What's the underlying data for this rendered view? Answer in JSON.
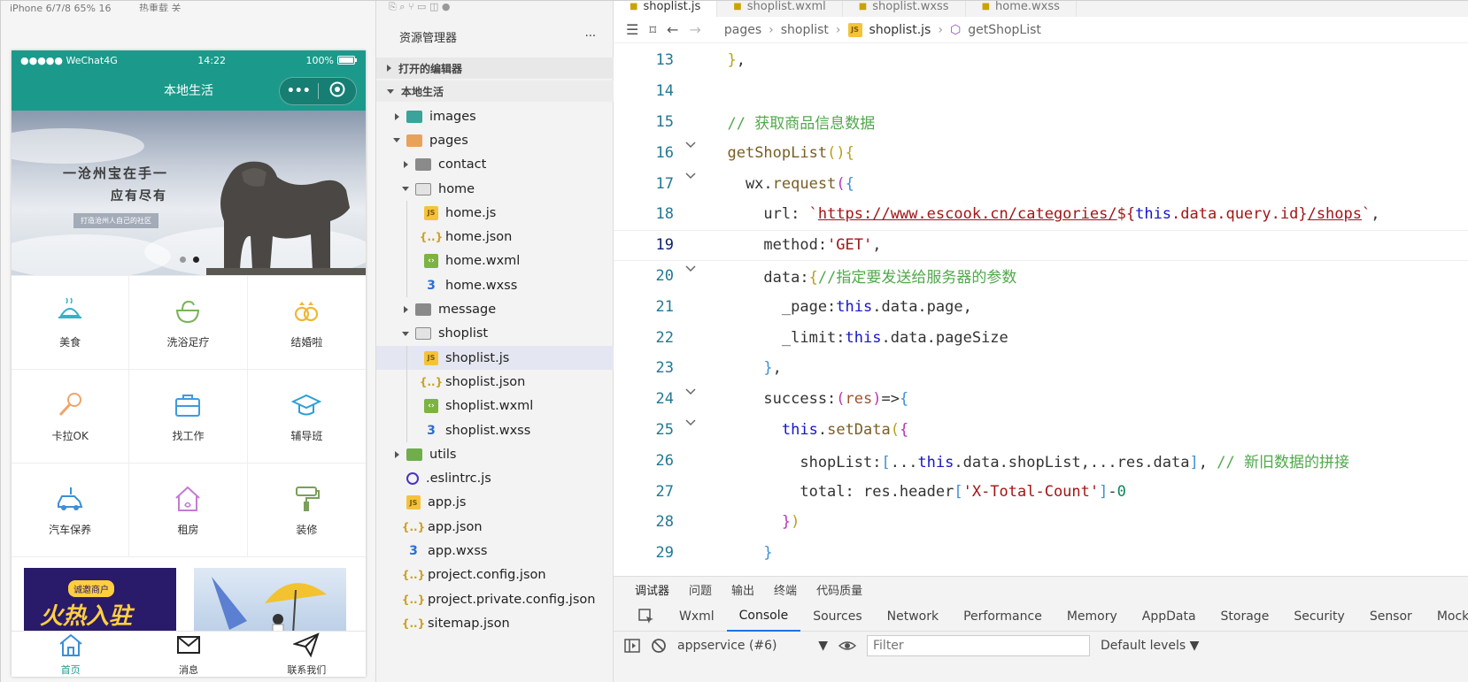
{
  "simulator": {
    "top_device": "iPhone 6/7/8 65% 16",
    "top_hot": "热重载 关",
    "status": {
      "carrier": "●●●●● WeChat4G",
      "time": "14:22",
      "battery": "100%"
    },
    "nav_title": "本地生活",
    "capsule_more": "•••",
    "banner": {
      "line1": "一沧州宝在手一",
      "line2": "应有尽有",
      "line3": "打造沧州人自己的社区"
    },
    "grid": [
      {
        "label": "美食",
        "icon": "food-icon"
      },
      {
        "label": "洗浴足疗",
        "icon": "bath-icon"
      },
      {
        "label": "结婚啦",
        "icon": "rings-icon"
      },
      {
        "label": "卡拉OK",
        "icon": "microphone-icon"
      },
      {
        "label": "找工作",
        "icon": "briefcase-icon"
      },
      {
        "label": "辅导班",
        "icon": "graduation-cap-icon"
      },
      {
        "label": "汽车保养",
        "icon": "car-icon"
      },
      {
        "label": "租房",
        "icon": "house-icon"
      },
      {
        "label": "装修",
        "icon": "paint-roller-icon"
      }
    ],
    "promo1": {
      "badge": "诚邀商户",
      "text": "火热入驻"
    },
    "tabbar": [
      {
        "label": "首页",
        "icon": "home-icon",
        "active": true
      },
      {
        "label": "消息",
        "icon": "envelope-icon",
        "active": false
      },
      {
        "label": "联系我们",
        "icon": "paper-plane-icon",
        "active": false
      }
    ]
  },
  "explorer": {
    "title": "资源管理器",
    "more": "···",
    "section_open": "打开的编辑器",
    "section_project": "本地生活",
    "tree": [
      {
        "label": "images",
        "depth": 0,
        "arrow": "right",
        "icon": "images-folder-icon"
      },
      {
        "label": "pages",
        "depth": 0,
        "arrow": "down",
        "icon": "pages-folder-icon"
      },
      {
        "label": "contact",
        "depth": 1,
        "arrow": "right",
        "icon": "folder-icon"
      },
      {
        "label": "home",
        "depth": 1,
        "arrow": "down",
        "icon": "folder-open-icon"
      },
      {
        "label": "home.js",
        "depth": 2,
        "arrow": "",
        "icon": "js-file-icon"
      },
      {
        "label": "home.json",
        "depth": 2,
        "arrow": "",
        "icon": "json-file-icon"
      },
      {
        "label": "home.wxml",
        "depth": 2,
        "arrow": "",
        "icon": "wxml-file-icon"
      },
      {
        "label": "home.wxss",
        "depth": 2,
        "arrow": "",
        "icon": "wxss-file-icon"
      },
      {
        "label": "message",
        "depth": 1,
        "arrow": "right",
        "icon": "folder-icon"
      },
      {
        "label": "shoplist",
        "depth": 1,
        "arrow": "down",
        "icon": "folder-open-icon"
      },
      {
        "label": "shoplist.js",
        "depth": 2,
        "arrow": "",
        "icon": "js-file-icon",
        "selected": true
      },
      {
        "label": "shoplist.json",
        "depth": 2,
        "arrow": "",
        "icon": "json-file-icon"
      },
      {
        "label": "shoplist.wxml",
        "depth": 2,
        "arrow": "",
        "icon": "wxml-file-icon"
      },
      {
        "label": "shoplist.wxss",
        "depth": 2,
        "arrow": "",
        "icon": "wxss-file-icon"
      },
      {
        "label": "utils",
        "depth": 0,
        "arrow": "right",
        "icon": "utils-folder-icon"
      },
      {
        "label": ".eslintrc.js",
        "depth": 0,
        "arrow": "",
        "icon": "eslint-file-icon"
      },
      {
        "label": "app.js",
        "depth": 0,
        "arrow": "",
        "icon": "js-file-icon"
      },
      {
        "label": "app.json",
        "depth": 0,
        "arrow": "",
        "icon": "json-file-icon"
      },
      {
        "label": "app.wxss",
        "depth": 0,
        "arrow": "",
        "icon": "wxss-file-icon"
      },
      {
        "label": "project.config.json",
        "depth": 0,
        "arrow": "",
        "icon": "json-file-icon"
      },
      {
        "label": "project.private.config.json",
        "depth": 0,
        "arrow": "",
        "icon": "json-file-icon"
      },
      {
        "label": "sitemap.json",
        "depth": 0,
        "arrow": "",
        "icon": "json-file-icon"
      }
    ]
  },
  "editor": {
    "tabs": [
      {
        "label": "shoplist.js",
        "active": true
      },
      {
        "label": "shoplist.wxml",
        "active": false
      },
      {
        "label": "shoplist.wxss",
        "active": false
      },
      {
        "label": "home.wxss",
        "active": false
      }
    ],
    "breadcrumb": [
      "pages",
      "shoplist",
      "shoplist.js",
      "getShopList"
    ],
    "current_line": 19,
    "lines": [
      {
        "n": "13",
        "fold": false
      },
      {
        "n": "14",
        "fold": false
      },
      {
        "n": "15",
        "fold": false
      },
      {
        "n": "16",
        "fold": true
      },
      {
        "n": "17",
        "fold": true
      },
      {
        "n": "18",
        "fold": false
      },
      {
        "n": "19",
        "fold": false
      },
      {
        "n": "20",
        "fold": true
      },
      {
        "n": "21",
        "fold": false
      },
      {
        "n": "22",
        "fold": false
      },
      {
        "n": "23",
        "fold": false
      },
      {
        "n": "24",
        "fold": true
      },
      {
        "n": "25",
        "fold": true
      },
      {
        "n": "26",
        "fold": false
      },
      {
        "n": "27",
        "fold": false
      },
      {
        "n": "28",
        "fold": false
      },
      {
        "n": "29",
        "fold": false
      }
    ]
  },
  "devtools": {
    "top_tabs": [
      "调试器",
      "问题",
      "输出",
      "终端",
      "代码质量"
    ],
    "panel_tabs": [
      "Wxml",
      "Console",
      "Sources",
      "Network",
      "Performance",
      "Memory",
      "AppData",
      "Storage",
      "Security",
      "Sensor",
      "Mock"
    ],
    "active_panel": "Console",
    "context": "appservice (#6)",
    "filter_placeholder": "Filter",
    "levels": "Default levels ▼"
  }
}
